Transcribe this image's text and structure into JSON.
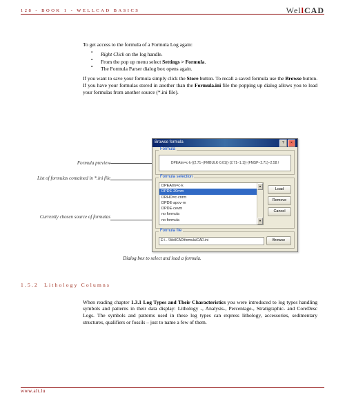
{
  "header": {
    "left": "128 - BOOK 1 - WELLCAD BASICS",
    "brand_pre": "Wel",
    "brand_post": "CAD"
  },
  "para_intro": "To get access to the formula of a Formula Log again:",
  "bullets": [
    {
      "pre": "",
      "it": "Right Click",
      "post": " on the log handle."
    },
    {
      "pre": "From the pop up menu select ",
      "b": "Settings > Formula",
      "post": "."
    },
    {
      "pre": "The Formula Parser dialog box opens again.",
      "it": "",
      "b": "",
      "post": ""
    }
  ],
  "para_save": {
    "t1": "If you want to save your formula simply click the ",
    "b1": "Store",
    "t2": " button. To recall a saved formula use the ",
    "b2": "Browse",
    "t3": " button. If you have your formulas stored in another than the ",
    "b3": "Formula.ini",
    "t4": " file the popping up dialog allows you to load your formulas from another source (*.ini file)."
  },
  "annotations": {
    "a1": "Formula preview",
    "a2": "List of formulas contained in *.ini file",
    "a3": "Currently chosen source of formulas"
  },
  "dialog": {
    "title": "Browse formula",
    "group1": "Formula",
    "preview": "DPEAtm=c·k·{(2.71−(FMBULK·0.01))·(2.71−1.1)}·(FMSP−2.71)−2.58 /",
    "group2": "Formula selection",
    "items": [
      "DPEAtm=c·k",
      "DPDE·20mm",
      "DRHO=c·cnrm",
      "DPDE·apov·m",
      "DPDE·cevm",
      "no formula",
      "no formula",
      "no formula",
      "no formula"
    ],
    "btn_load": "Load",
    "btn_remove": "Remove",
    "btn_cancel": "Cancel",
    "group3": "Formula file",
    "path": "E:\\…\\WellCAD\\formula\\CAD.ini",
    "btn_browse": "Browse"
  },
  "caption": "Dialog box to select and load a formula.",
  "section": {
    "num": "1.5.2",
    "title": "Lithology Columns"
  },
  "para2": {
    "t1": "When reading chapter ",
    "b1": "1.3.1 Log Types and Their Characteristics",
    "t2": " you were introduced to log types handling symbols and patterns in their data display: Lithology -, Analysis-, Percentage-, Stratigraphic- and CoreDesc Logs. The symbols and patterns used in these log types can express lithology, accessories, sedimentary structures, qualifiers or fossils – just to name a few of them."
  },
  "footer": "www.alt.lu"
}
